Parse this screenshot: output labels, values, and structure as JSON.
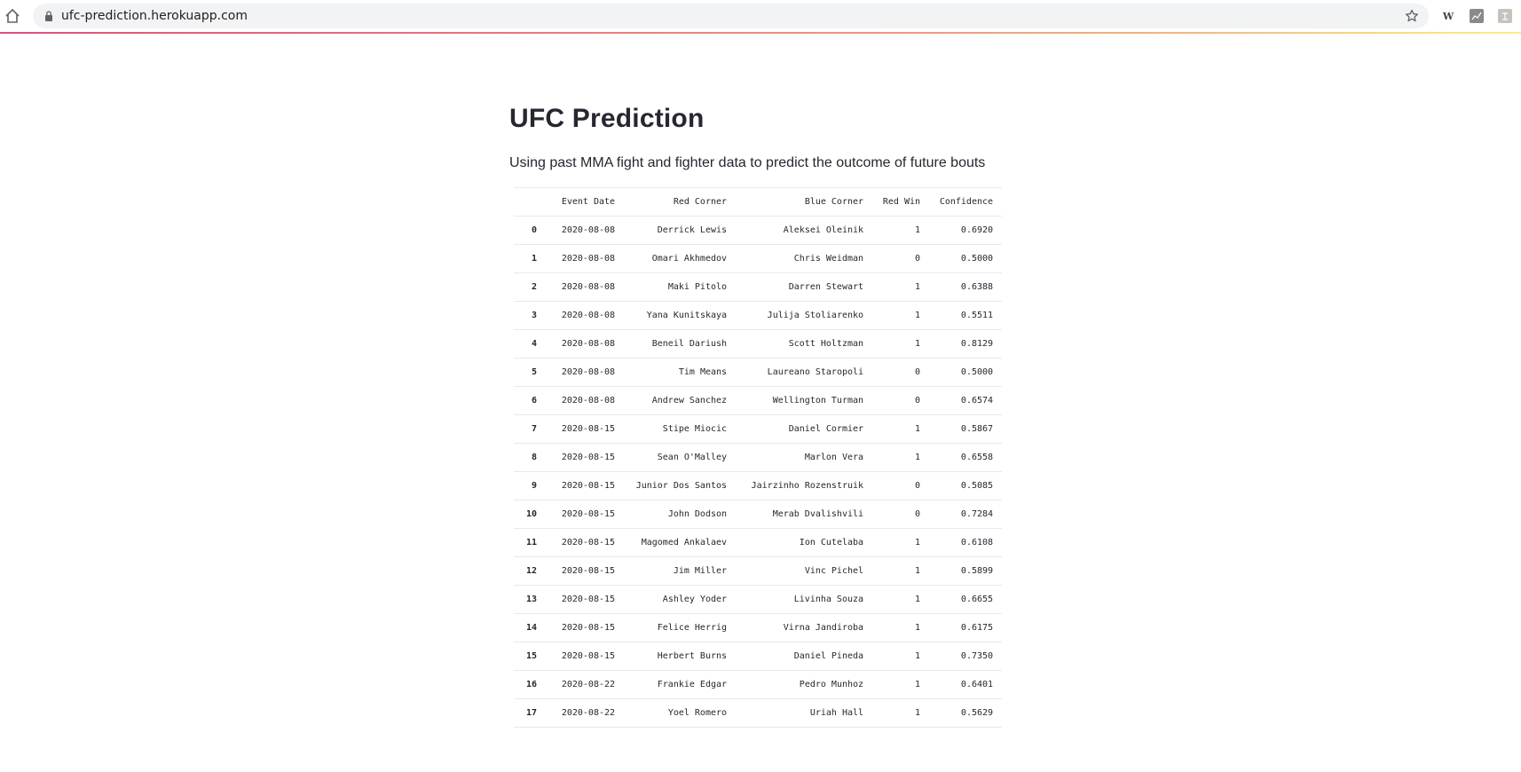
{
  "browser": {
    "url": "ufc-prediction.herokuapp.com",
    "ext_w_label": "W"
  },
  "page": {
    "title": "UFC Prediction",
    "subtitle": "Using past MMA fight and fighter data to predict the outcome of future bouts"
  },
  "table": {
    "columns": [
      "",
      "Event Date",
      "Red Corner",
      "Blue Corner",
      "Red Win",
      "Confidence"
    ],
    "rows": [
      [
        "0",
        "2020-08-08",
        "Derrick Lewis",
        "Aleksei Oleinik",
        "1",
        "0.6920"
      ],
      [
        "1",
        "2020-08-08",
        "Omari Akhmedov",
        "Chris Weidman",
        "0",
        "0.5000"
      ],
      [
        "2",
        "2020-08-08",
        "Maki Pitolo",
        "Darren Stewart",
        "1",
        "0.6388"
      ],
      [
        "3",
        "2020-08-08",
        "Yana Kunitskaya",
        "Julija Stoliarenko",
        "1",
        "0.5511"
      ],
      [
        "4",
        "2020-08-08",
        "Beneil Dariush",
        "Scott Holtzman",
        "1",
        "0.8129"
      ],
      [
        "5",
        "2020-08-08",
        "Tim Means",
        "Laureano Staropoli",
        "0",
        "0.5000"
      ],
      [
        "6",
        "2020-08-08",
        "Andrew Sanchez",
        "Wellington Turman",
        "0",
        "0.6574"
      ],
      [
        "7",
        "2020-08-15",
        "Stipe Miocic",
        "Daniel Cormier",
        "1",
        "0.5867"
      ],
      [
        "8",
        "2020-08-15",
        "Sean O'Malley",
        "Marlon Vera",
        "1",
        "0.6558"
      ],
      [
        "9",
        "2020-08-15",
        "Junior Dos Santos",
        "Jairzinho Rozenstruik",
        "0",
        "0.5085"
      ],
      [
        "10",
        "2020-08-15",
        "John Dodson",
        "Merab Dvalishvili",
        "0",
        "0.7284"
      ],
      [
        "11",
        "2020-08-15",
        "Magomed Ankalaev",
        "Ion Cutelaba",
        "1",
        "0.6108"
      ],
      [
        "12",
        "2020-08-15",
        "Jim Miller",
        "Vinc Pichel",
        "1",
        "0.5899"
      ],
      [
        "13",
        "2020-08-15",
        "Ashley Yoder",
        "Livinha Souza",
        "1",
        "0.6655"
      ],
      [
        "14",
        "2020-08-15",
        "Felice Herrig",
        "Virna Jandiroba",
        "1",
        "0.6175"
      ],
      [
        "15",
        "2020-08-15",
        "Herbert Burns",
        "Daniel Pineda",
        "1",
        "0.7350"
      ],
      [
        "16",
        "2020-08-22",
        "Frankie Edgar",
        "Pedro Munhoz",
        "1",
        "0.6401"
      ],
      [
        "17",
        "2020-08-22",
        "Yoel Romero",
        "Uriah Hall",
        "1",
        "0.5629"
      ]
    ]
  }
}
